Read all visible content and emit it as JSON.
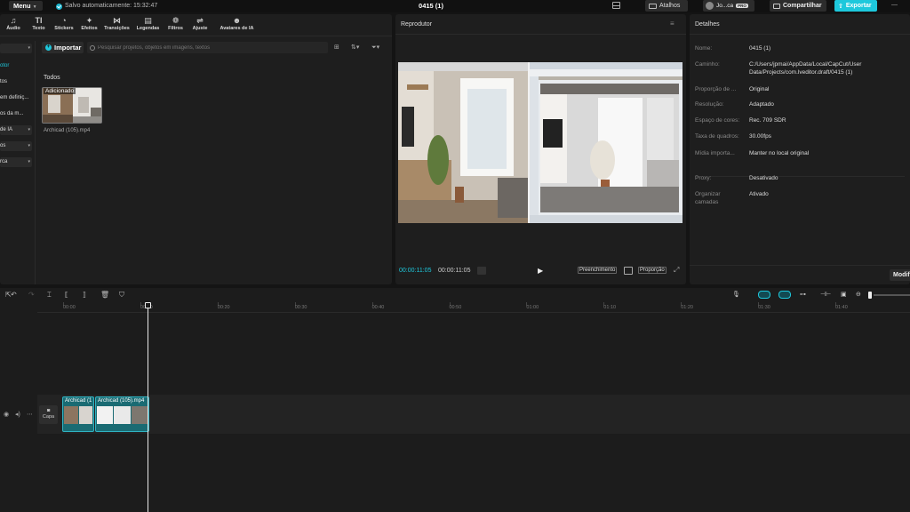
{
  "titlebar": {
    "menu_label": "Menu",
    "autosave_text": "Salvo automaticamente: 15:32:47",
    "project_title": "0415 (1)",
    "shortcuts_label": "Atalhos",
    "user_name": "Jo...ca",
    "pro_badge": "PRO",
    "share_label": "Compartilhar",
    "export_label": "Exportar",
    "minimize_glyph": "—"
  },
  "toolbar": {
    "tabs": [
      {
        "label": "Áudio",
        "icon": "audio-icon",
        "glyph": "♫"
      },
      {
        "label": "Texto",
        "icon": "text-icon",
        "glyph": "TI"
      },
      {
        "label": "Stickers",
        "icon": "sticker-icon",
        "glyph": "◔"
      },
      {
        "label": "Efeitos",
        "icon": "effects-icon",
        "glyph": "✦"
      },
      {
        "label": "Transições",
        "icon": "transitions-icon",
        "glyph": "⋈"
      },
      {
        "label": "Legendas",
        "icon": "captions-icon",
        "glyph": "▤"
      },
      {
        "label": "Filtros",
        "icon": "filters-icon",
        "glyph": "❁"
      },
      {
        "label": "Ajuste",
        "icon": "adjust-icon",
        "glyph": "⇌"
      },
      {
        "label": "Avatares de IA",
        "icon": "ai-avatar-icon",
        "glyph": "☻"
      }
    ]
  },
  "sidebar": {
    "items": [
      {
        "label": "",
        "boxed": true
      },
      {
        "label": "otor",
        "selected": true
      },
      {
        "label": "tos"
      },
      {
        "label": "em definiç..."
      },
      {
        "label": "os da m..."
      },
      {
        "label": "de IA",
        "boxed": true
      },
      {
        "label": "os",
        "boxed": true
      },
      {
        "label": "rca",
        "boxed": true
      }
    ]
  },
  "media": {
    "import_label": "Importar",
    "search_placeholder": "Pesquisar projetos, objetos em imagens, textos",
    "section_label": "Todos",
    "thumb_badge": "Adicionado",
    "filename": "Archicad (105).mp4"
  },
  "player": {
    "title": "Reprodutor",
    "time_current": "00:00:11:05",
    "time_total": "00:00:11:05",
    "fill_label": "Preenchimento",
    "ratio_label": "Proporção"
  },
  "details": {
    "title": "Detalhes",
    "rows": [
      {
        "label": "Nome:",
        "value": "0415 (1)"
      },
      {
        "label": "Caminho:",
        "value": "C:/Users/jpmai/AppData/Local/CapCut/User Data/Projects/com.lveditor.draft/0415 (1)"
      },
      {
        "label": "Proporção de ...",
        "value": "Original"
      },
      {
        "label": "Resolução:",
        "value": "Adaptado"
      },
      {
        "label": "Espaço de cores:",
        "value": "Rec. 709 SDR"
      },
      {
        "label": "Taxa de quadros:",
        "value": "30.00fps"
      },
      {
        "label": "Mídia importa...",
        "value": "Manter no local original"
      }
    ],
    "rows2": [
      {
        "label": "Proxy:",
        "value": "Desativado"
      },
      {
        "label": "Organizar camadas",
        "value": "Ativado"
      }
    ],
    "modify_label": "Modif"
  },
  "timeline": {
    "ruler": [
      "00:00",
      "00:10",
      "00:20",
      "00:30",
      "00:40",
      "00:50",
      "01:00",
      "01:10",
      "01:20",
      "01:30",
      "01:40"
    ],
    "cover_label": "Capa",
    "clips": [
      {
        "label": "Archicad (1"
      },
      {
        "label": "Archicad (105).mp4"
      }
    ]
  },
  "colors": {
    "accent": "#1ec8dc",
    "panel": "#1e1e1e",
    "background": "#141414",
    "clip": "#1a6b73"
  }
}
